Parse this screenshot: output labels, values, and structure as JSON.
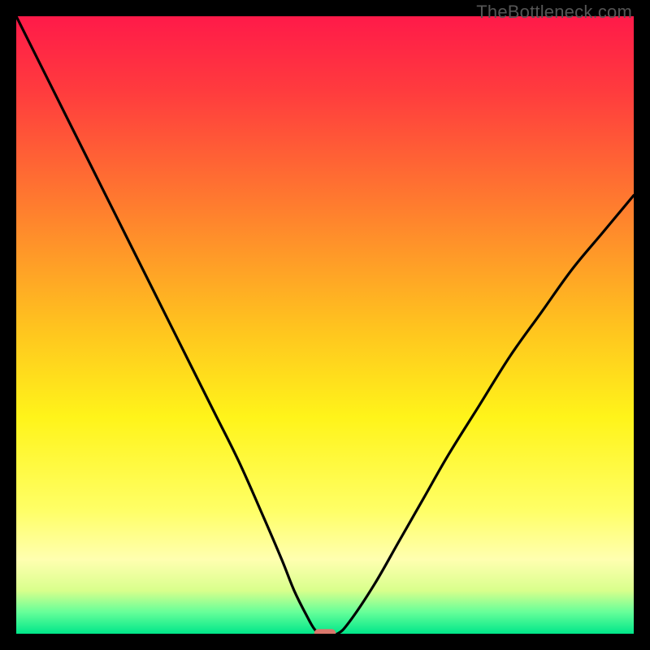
{
  "watermark": "TheBottleneck.com",
  "chart_data": {
    "type": "line",
    "title": "",
    "xlabel": "",
    "ylabel": "",
    "xlim": [
      0,
      100
    ],
    "ylim": [
      0,
      100
    ],
    "grid": false,
    "legend": false,
    "background_gradient": {
      "stops": [
        {
          "offset": 0.0,
          "color": "#ff1a49"
        },
        {
          "offset": 0.12,
          "color": "#ff3b3e"
        },
        {
          "offset": 0.3,
          "color": "#ff7a2f"
        },
        {
          "offset": 0.5,
          "color": "#ffc21f"
        },
        {
          "offset": 0.65,
          "color": "#fff41a"
        },
        {
          "offset": 0.8,
          "color": "#ffff66"
        },
        {
          "offset": 0.88,
          "color": "#ffffb0"
        },
        {
          "offset": 0.93,
          "color": "#d9ff8c"
        },
        {
          "offset": 0.965,
          "color": "#66ff99"
        },
        {
          "offset": 1.0,
          "color": "#00e68a"
        }
      ]
    },
    "series": [
      {
        "name": "bottleneck-curve",
        "x": [
          0,
          4,
          8,
          12,
          16,
          20,
          24,
          28,
          32,
          36,
          40,
          43,
          45,
          47,
          48.5,
          50,
          52,
          54,
          58,
          62,
          66,
          70,
          75,
          80,
          85,
          90,
          95,
          100
        ],
        "y": [
          100,
          92,
          84,
          76,
          68,
          60,
          52,
          44,
          36,
          28,
          19,
          12,
          7,
          3,
          0.5,
          0,
          0,
          2,
          8,
          15,
          22,
          29,
          37,
          45,
          52,
          59,
          65,
          71
        ]
      }
    ],
    "marker": {
      "name": "optimal-point",
      "x": 50,
      "y": 0,
      "color": "#d9776c",
      "width": 3.5,
      "height": 1.5
    }
  }
}
